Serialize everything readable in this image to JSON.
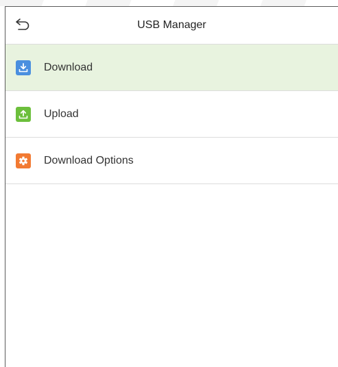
{
  "header": {
    "title": "USB Manager",
    "back_icon": "back-arrow-icon"
  },
  "menu": {
    "selected_index": 0,
    "items": [
      {
        "label": "Download",
        "icon": "download-icon",
        "icon_color": "#4a8fdf"
      },
      {
        "label": "Upload",
        "icon": "upload-icon",
        "icon_color": "#6cbf3c"
      },
      {
        "label": "Download Options",
        "icon": "gear-icon",
        "icon_color": "#f27a32"
      }
    ]
  },
  "colors": {
    "selected_row": "#e8f3df",
    "divider": "#dcdcdc",
    "frame_border": "#5a5a5a"
  }
}
